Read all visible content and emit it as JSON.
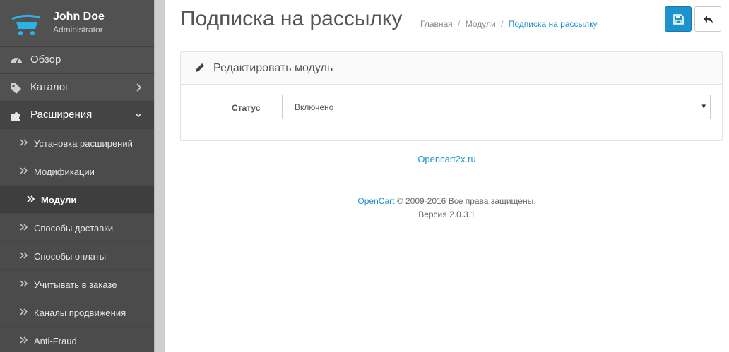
{
  "profile": {
    "name": "John Doe",
    "role": "Administrator"
  },
  "sidebar": {
    "items": [
      {
        "label": "Обзор",
        "icon": "dashboard-icon"
      },
      {
        "label": "Каталог",
        "icon": "tags-icon"
      },
      {
        "label": "Расширения",
        "icon": "puzzle-icon"
      }
    ],
    "submenu": [
      {
        "label": "Установка расширений"
      },
      {
        "label": "Модификации"
      },
      {
        "label": "Модули"
      },
      {
        "label": "Способы доставки"
      },
      {
        "label": "Способы оплаты"
      },
      {
        "label": "Учитывать в заказе"
      },
      {
        "label": "Каналы продвижения"
      },
      {
        "label": "Anti-Fraud"
      }
    ]
  },
  "header": {
    "title": "Подписка на рассылку",
    "breadcrumb": [
      "Главная",
      "Модули",
      "Подписка на рассылку"
    ]
  },
  "panel": {
    "heading": "Редактировать модуль",
    "status_label": "Статус",
    "status_value": "Включено"
  },
  "footer": {
    "site_link": "Opencart2x.ru",
    "brand": "OpenCart",
    "copyright": "© 2009-2016 Все права защищены.",
    "version": "Версия 2.0.3.1"
  },
  "colors": {
    "accent": "#1e91cf",
    "sidebar": "#515151"
  }
}
